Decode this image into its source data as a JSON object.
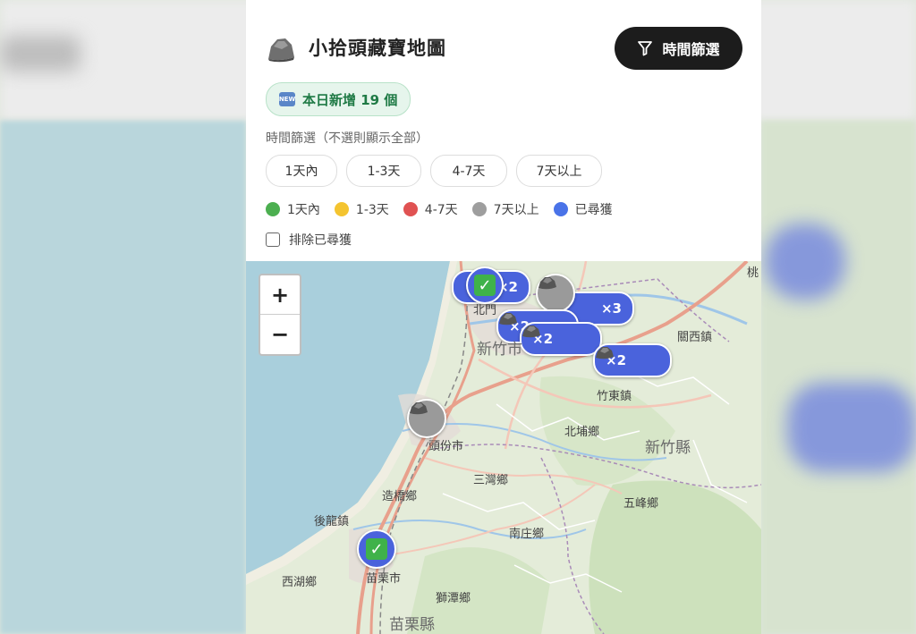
{
  "app": {
    "title": "小拾頭藏寶地圖",
    "filter_button_label": "時間篩選",
    "today_badge": "本日新增 19 個",
    "new_icon_text": "NEW",
    "filter_section_label": "時間篩選（不選則顯示全部）",
    "time_filters": [
      "1天內",
      "1-3天",
      "4-7天",
      "7天以上"
    ],
    "legend": [
      {
        "label": "1天內",
        "color": "#4caf50"
      },
      {
        "label": "1-3天",
        "color": "#f4c430"
      },
      {
        "label": "4-7天",
        "color": "#e05252"
      },
      {
        "label": "7天以上",
        "color": "#9e9e9e"
      },
      {
        "label": "已尋獲",
        "color": "#4a73e8"
      }
    ],
    "exclude_found_label": "排除已尋獲",
    "exclude_found_checked": false
  },
  "map": {
    "zoom_in": "+",
    "zoom_out": "−",
    "places": {
      "taoyuan": "桃",
      "beibei": "北門",
      "hsinchu_city": "新竹市",
      "guanxi": "關西鎮",
      "zhudong": "竹東鎮",
      "beipu": "北埔鄉",
      "hsinchu_county": "新竹縣",
      "toufen": "頭份市",
      "sanwan": "三灣鄉",
      "zaoqiao": "造橋鄉",
      "houlong": "後龍鎮",
      "wufeng": "五峰鄉",
      "nanzhuang": "南庄鄉",
      "miaoli_city": "苗栗市",
      "xihu": "西湖鄉",
      "shitan": "獅潭鄉",
      "miaoli_county": "苗栗縣"
    },
    "cluster_counts": {
      "a": "×2",
      "b": "×3",
      "c": "×2",
      "d": "×2",
      "e": "×2"
    },
    "check_glyph": "✓"
  }
}
